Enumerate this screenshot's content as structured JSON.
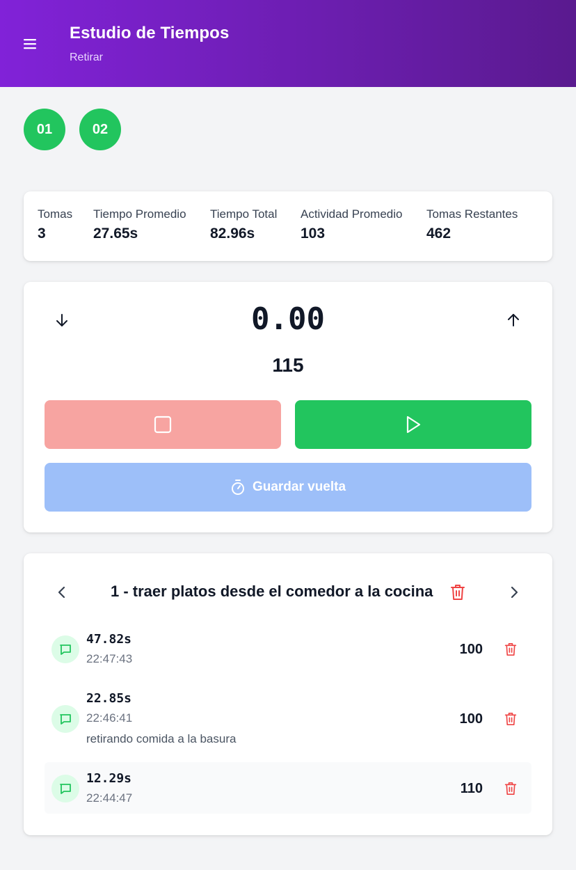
{
  "header": {
    "title": "Estudio de Tiempos",
    "subtitle": "Retirar",
    "menu_icon": "hamburger-menu-icon"
  },
  "elements": [
    {
      "label": "01",
      "color": "#22c55e"
    },
    {
      "label": "02",
      "color": "#22c55e"
    }
  ],
  "stats": [
    {
      "label": "Tomas",
      "value": "3"
    },
    {
      "label": "Tiempo Promedio",
      "value": "27.65s"
    },
    {
      "label": "Tiempo Total",
      "value": "82.96s"
    },
    {
      "label": "Actividad Promedio",
      "value": "103"
    },
    {
      "label": "Tomas Restantes",
      "value": "462"
    }
  ],
  "timer": {
    "display": "0.00",
    "activity": "115",
    "decrease_icon": "arrow-down-icon",
    "increase_icon": "arrow-up-icon",
    "stop_icon": "stop-icon",
    "play_icon": "play-icon",
    "lap_label": "Guardar vuelta",
    "lap_icon": "stopwatch-icon"
  },
  "laps_panel": {
    "task_title": "1 - traer platos desde el comedor a la cocina",
    "laps": [
      {
        "time": "47.82s",
        "clock": "22:47:43",
        "note": "",
        "activity": "100"
      },
      {
        "time": "22.85s",
        "clock": "22:46:41",
        "note": "retirando comida a la basura",
        "activity": "100"
      },
      {
        "time": "12.29s",
        "clock": "22:44:47",
        "note": "",
        "activity": "110"
      }
    ]
  },
  "colors": {
    "header_gradient_start": "#8122d8",
    "header_gradient_end": "#5a1a8f",
    "green": "#22c55e",
    "stop_red": "#f7a4a1",
    "lap_blue": "#9dbff9",
    "trash_red": "#ef4444"
  }
}
